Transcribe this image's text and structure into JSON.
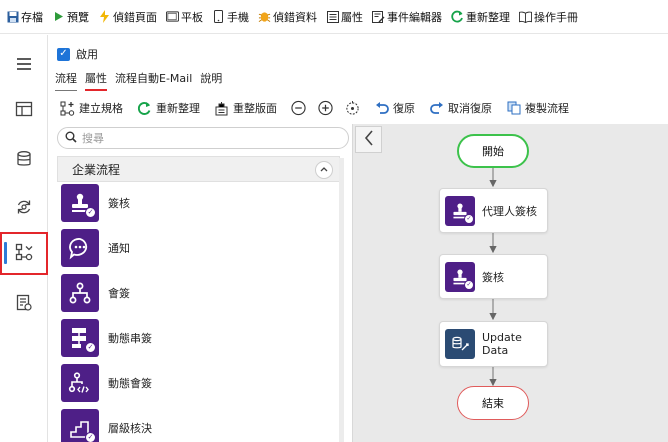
{
  "toolbar": {
    "items": [
      {
        "label": "存檔",
        "icon": "save-icon"
      },
      {
        "label": "預覽",
        "icon": "play-icon"
      },
      {
        "label": "偵錯頁面",
        "icon": "lightning-icon"
      },
      {
        "label": "平板",
        "icon": "tablet-icon"
      },
      {
        "label": "手機",
        "icon": "phone-icon"
      },
      {
        "label": "偵錯資料",
        "icon": "bug-icon"
      },
      {
        "label": "屬性",
        "icon": "properties-icon"
      },
      {
        "label": "事件編輯器",
        "icon": "event-editor-icon"
      },
      {
        "label": "重新整理",
        "icon": "refresh-icon"
      },
      {
        "label": "操作手冊",
        "icon": "manual-icon"
      }
    ]
  },
  "rail": [
    "menu-icon",
    "layout-icon",
    "database-icon",
    "sync-icon",
    "flow-icon",
    "report-icon"
  ],
  "enable": {
    "label": "啟用",
    "checked": true
  },
  "tabs": [
    "流程",
    "屬性",
    "流程自動E-Mail",
    "說明"
  ],
  "flow_toolbar": {
    "create_spec": "建立規格",
    "refresh": "重新整理",
    "reorganize": "重整版面",
    "undo": "復原",
    "redo": "取消復原",
    "copy_flow": "複製流程"
  },
  "palette": {
    "search_placeholder": "搜尋",
    "group_title": "企業流程",
    "items": [
      "簽核",
      "通知",
      "會簽",
      "動態串簽",
      "動態會簽",
      "層級核決"
    ]
  },
  "flow": {
    "start": "開始",
    "nodes": [
      "代理人簽核",
      "簽核",
      "Update Data"
    ],
    "end": "結束"
  },
  "colors": {
    "accent_purple": "#4e1f87",
    "start_border": "#3cc24b",
    "end_border": "#e05b5b",
    "db_icon": "#2b4b73",
    "highlight_red": "#e3262b"
  }
}
